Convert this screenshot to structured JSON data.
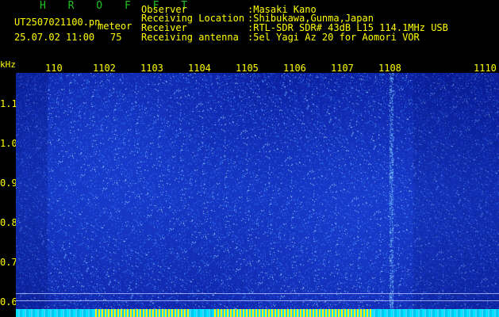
{
  "station": {
    "name": "H R O F F T",
    "file": "UT2507021100.pn",
    "event": "meteor",
    "datetime": "25.07.02 11:00",
    "count": "75"
  },
  "info": [
    {
      "label": "Observer",
      "value": ":Masaki Kano"
    },
    {
      "label": "Receiving Location",
      "value": ":Shibukawa,Gunma,Japan"
    },
    {
      "label": "Receiver",
      "value": ":RTL-SDR SDR# 43dB L15 114.1MHz USB"
    },
    {
      "label": "Receiving antenna",
      "value": ":5el Yagi Az 20 for Aomori VOR"
    }
  ],
  "x_axis": {
    "unit": "kHz",
    "ticks": [
      "110",
      "1102",
      "1103",
      "1104",
      "1105",
      "1106",
      "1107",
      "1108",
      "1110"
    ]
  },
  "y_axis": {
    "ticks": [
      "1.1",
      "1.0",
      "0.9",
      "0.8",
      "0.7",
      "0.6"
    ]
  },
  "colors": {
    "text": "#ffff00",
    "title": "#21c321",
    "background": "#000000",
    "spectrogram": "#1330b8"
  }
}
